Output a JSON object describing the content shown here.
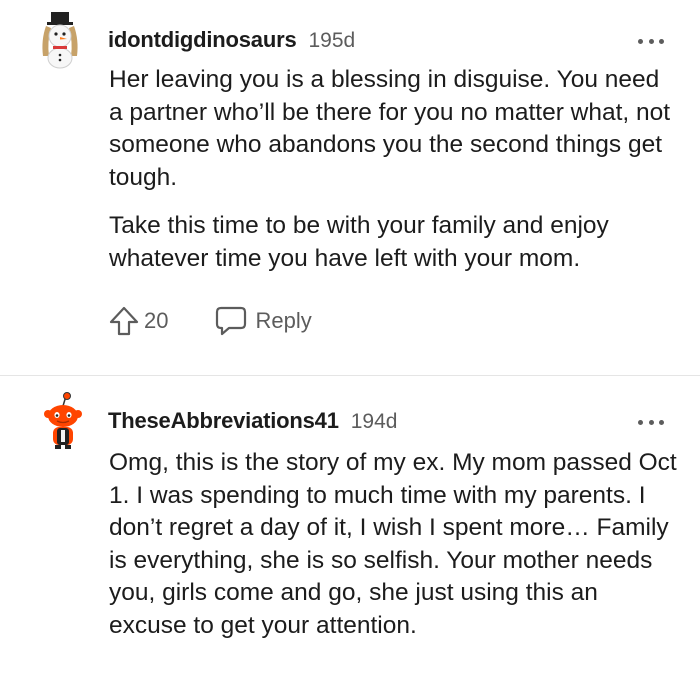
{
  "comments": [
    {
      "username": "idontdigdinosaurs",
      "age": "195d",
      "paragraphs": [
        "Her leaving you is a blessing in disguise. You need a partner who’ll be there for you no matter what, not someone who abandons you the second things get tough.",
        "Take this time to be with your family and enjoy whatever time you have left with your mom."
      ],
      "votes": "20",
      "reply_label": "Reply",
      "avatar_icon": "snowman-avatar-icon"
    },
    {
      "username": "TheseAbbreviations41",
      "age": "194d",
      "paragraphs": [
        "Omg, this is the story of my ex. My mom passed Oct 1. I was spending to much time with my parents. I don’t regret a day of it, I wish I spent more… Family is everything, she is so selfish. Your mother needs you, girls come and go, she just using this an excuse to get your attention."
      ],
      "avatar_icon": "snoo-avatar-icon"
    }
  ],
  "colors": {
    "text": "#1c1c1c",
    "meta": "#5c5c5c",
    "snoo_orange": "#ff4500",
    "divider": "#e5e5e5"
  }
}
